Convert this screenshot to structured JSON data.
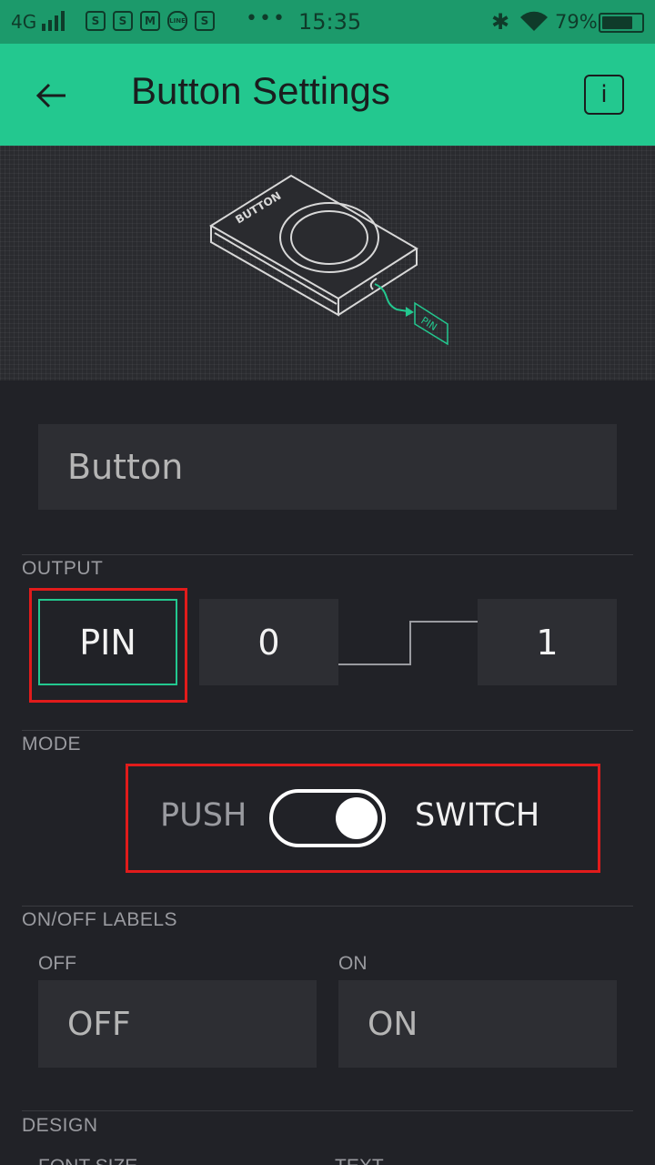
{
  "status_bar": {
    "network": "4G",
    "app_icons": [
      "S",
      "S",
      "M",
      "LINE",
      "S"
    ],
    "more": "•••",
    "time": "15:35",
    "battery_percent": "79%",
    "battery_level": 0.79
  },
  "header": {
    "title": "Button Settings",
    "back_icon": "arrow-left-icon",
    "info_label": "i"
  },
  "hero": {
    "device_label": "BUTTON",
    "pin_label": "PIN"
  },
  "name_field": {
    "placeholder": "Button"
  },
  "output": {
    "section_label": "OUTPUT",
    "pin_button": "PIN",
    "min_value": "0",
    "max_value": "1"
  },
  "mode": {
    "section_label": "MODE",
    "left_label": "PUSH",
    "right_label": "SWITCH",
    "selected": "SWITCH"
  },
  "onoff_labels": {
    "section_label": "ON/OFF LABELS",
    "off_label": "OFF",
    "on_label": "ON",
    "off_placeholder": "OFF",
    "on_placeholder": "ON"
  },
  "design": {
    "section_label": "DESIGN",
    "font_size_label": "FONT SIZE",
    "text_label": "TEXT"
  },
  "colors": {
    "accent": "#23c88f",
    "status_bar": "#1c9a6b",
    "background": "#212227",
    "field": "#2d2e33",
    "highlight": "#e11b1b"
  }
}
